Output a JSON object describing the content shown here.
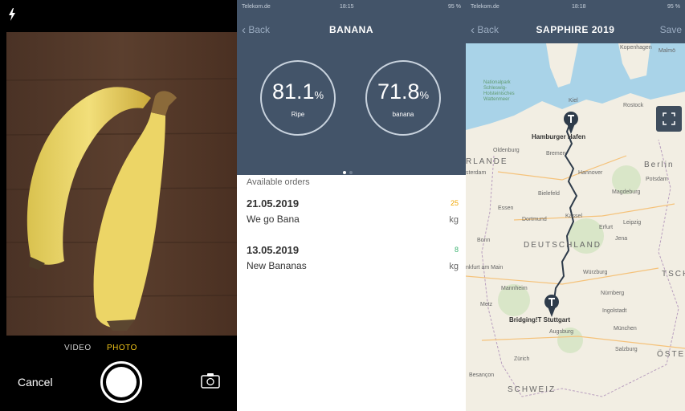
{
  "camera": {
    "mode_video": "VIDEO",
    "mode_photo": "PHOTO",
    "cancel_label": "Cancel",
    "icons": [
      "flash-icon",
      "shutter-button",
      "flip-camera-icon"
    ],
    "accent_color": "#f0c419"
  },
  "detail": {
    "status_left": "Telekom.de",
    "status_time": "18:15",
    "status_right": "95 %",
    "back_label": "Back",
    "title": "BANANA",
    "gauges": [
      {
        "value": "81.1",
        "unit": "%",
        "label": "Ripe",
        "fraction": 0.811
      },
      {
        "value": "71.8",
        "unit": "%",
        "label": "banana",
        "fraction": 0.718
      }
    ],
    "available_label": "Available orders",
    "orders": [
      {
        "date": "21.05.2019",
        "name": "We go Bana",
        "qty": "25",
        "unit": "kg",
        "qty_color": "#f0a500"
      },
      {
        "date": "13.05.2019",
        "name": "New Bananas",
        "qty": "8",
        "unit": "kg",
        "qty_color": "#3cb371"
      }
    ],
    "header_color": "#435469"
  },
  "map": {
    "status_left": "Telekom.de",
    "status_time": "18:18",
    "status_right": "95 %",
    "back_label": "Back",
    "title": "SAPPHIRE 2019",
    "save_label": "Save",
    "start": "Hamburger Hafen",
    "end": "Bridging!T Stuttgart",
    "labels": {
      "kopenhagen": "Kopenhagen",
      "malmo": "Malmö",
      "water": "Nationalpark Schleswig-Holsteinisches Wattenmeer",
      "rostock": "Rostock",
      "kiel": "Kiel",
      "oldenburg": "Oldenburg",
      "bremen": "Bremen",
      "berlin": "Berlin",
      "potsdam": "Potsdam",
      "hannover": "Hannover",
      "magdeburg": "Magdeburg",
      "bielefeld": "Bielefeld",
      "essen": "Essen",
      "leipzig": "Leipzig",
      "dortmund": "Dortmund",
      "kassel": "Kassel",
      "erfurt": "Erfurt",
      "bonn": "Bonn",
      "jena": "Jena",
      "deutschland": "DEUTSCHLAND",
      "frankfurt": "Frankfurt am Main",
      "wurzburg": "Würzburg",
      "mannheim": "Mannheim",
      "nurnberg": "Nürnberg",
      "metz": "Metz",
      "ingolstadt": "Ingolstadt",
      "augsburg": "Augsburg",
      "munchen": "München",
      "salzburg": "Salzburg",
      "zurich": "Zürich",
      "schweiz": "SCHWEIZ",
      "osterreich": "ÖSTE",
      "tsch": "TSCH",
      "lande": "RLANDE",
      "sterdam": "sterdam",
      "kfurt": "nkfurt am Main",
      "besancon": "Besançon"
    },
    "icons": [
      "map-pin-icon",
      "map-pin-icon",
      "expand-map-icon"
    ]
  }
}
